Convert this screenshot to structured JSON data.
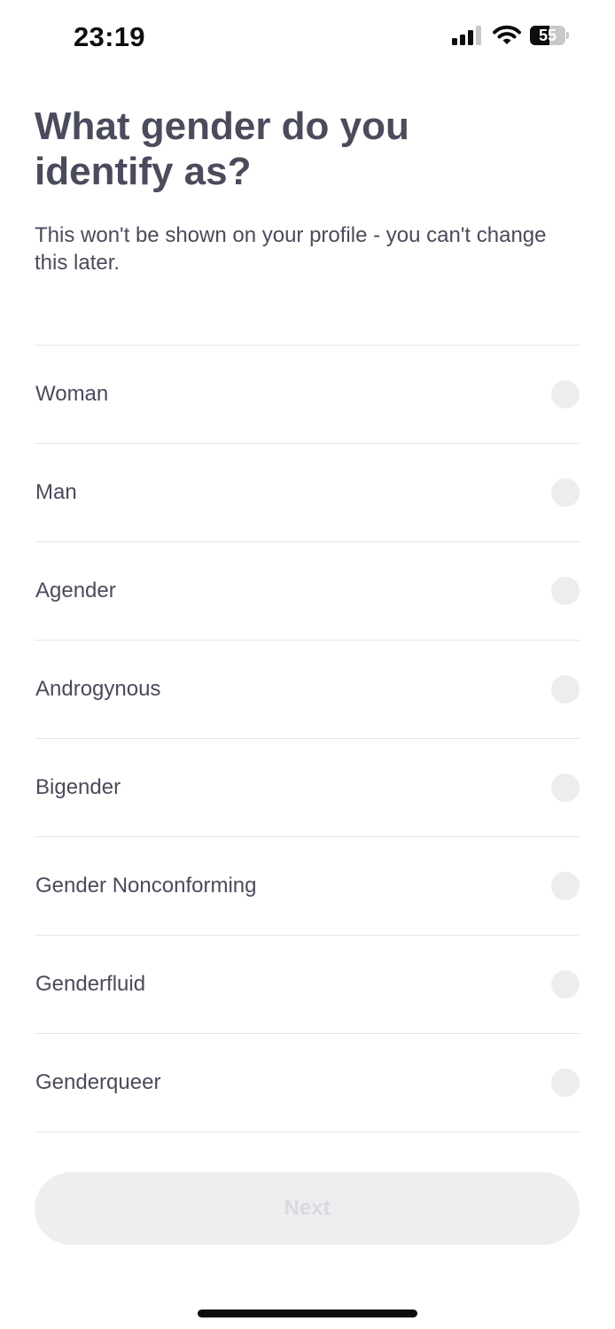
{
  "status_bar": {
    "time": "23:19",
    "battery_level": "55",
    "battery_fraction": 0.55,
    "icons": [
      "signal-icon",
      "wifi-icon",
      "battery-icon"
    ]
  },
  "header": {
    "title": "What gender do you identify as?",
    "subtitle": "This won't be shown on your profile - you can't change this later."
  },
  "options": [
    {
      "label": "Woman",
      "selected": false
    },
    {
      "label": "Man",
      "selected": false
    },
    {
      "label": "Agender",
      "selected": false
    },
    {
      "label": "Androgynous",
      "selected": false
    },
    {
      "label": "Bigender",
      "selected": false
    },
    {
      "label": "Gender Nonconforming",
      "selected": false
    },
    {
      "label": "Genderfluid",
      "selected": false
    },
    {
      "label": "Genderqueer",
      "selected": false
    }
  ],
  "footer": {
    "next_label": "Next",
    "next_enabled": false
  },
  "colors": {
    "text": "#4a4b5c",
    "divider": "#e6e6ea",
    "radio_unselected": "#ededf0",
    "button_disabled_bg": "#eeeef1",
    "button_disabled_text": "#dadade"
  }
}
